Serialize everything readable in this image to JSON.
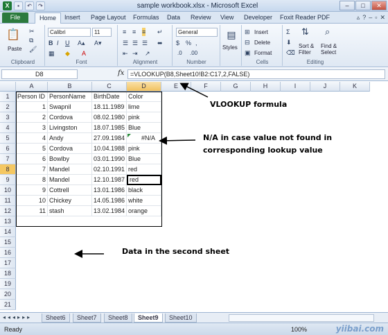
{
  "window": {
    "title": "sample workbook.xlsx - Microsoft Excel",
    "buttons": [
      "–",
      "□",
      "✕"
    ]
  },
  "tabs": [
    "File",
    "Home",
    "Insert",
    "Page Layout",
    "Formulas",
    "Data",
    "Review",
    "View",
    "Developer",
    "Foxit Reader PDF"
  ],
  "ribbon": {
    "paste": "Paste",
    "font_name": "Calibri",
    "font_size": "11",
    "bold": "B",
    "italic": "I",
    "underline": "U",
    "number_format": "General",
    "styles": "Styles",
    "insert": "Insert",
    "delete": "Delete",
    "format": "Format",
    "sort_filter": "Sort & Filter",
    "find_select": "Find & Select",
    "groups": [
      "Clipboard",
      "Font",
      "Alignment",
      "Number",
      "Cells",
      "Editing"
    ]
  },
  "formula_bar": {
    "name_box": "D8",
    "fx": "fx",
    "formula": "=VLOOKUP(B8,Sheet10!B2:C17,2,FALSE)"
  },
  "columns": [
    "A",
    "B",
    "C",
    "D",
    "E",
    "F",
    "G",
    "H",
    "I",
    "J",
    "K"
  ],
  "rows": [
    "1",
    "2",
    "3",
    "4",
    "5",
    "6",
    "7",
    "8",
    "9",
    "10",
    "11",
    "12",
    "13",
    "14",
    "15",
    "16",
    "17",
    "18",
    "19",
    "20",
    "21"
  ],
  "table": {
    "headers": [
      "Person ID",
      "PersonName",
      "BirthDate",
      "Color"
    ],
    "rows": [
      [
        "1",
        "Swapnil",
        "18.11.1989",
        "lime"
      ],
      [
        "2",
        "Cordova",
        "08.02.1980",
        "pink"
      ],
      [
        "3",
        "Livingston",
        "18.07.1985",
        "Blue"
      ],
      [
        "4",
        "Andy",
        "27.09.1984",
        "#N/A"
      ],
      [
        "5",
        "Cordova",
        "10.04.1988",
        "pink"
      ],
      [
        "6",
        "Bowlby",
        "03.01.1990",
        "Blue"
      ],
      [
        "7",
        "Mandel",
        "02.10.1991",
        "red"
      ],
      [
        "8",
        "Mandel",
        "12.10.1987",
        "red"
      ],
      [
        "9",
        "Cottrell",
        "13.01.1986",
        "black"
      ],
      [
        "10",
        "Chickey",
        "14.05.1986",
        "white"
      ],
      [
        "11",
        "stash",
        "13.02.1984",
        "orange"
      ]
    ]
  },
  "annotations": {
    "vlookup": "VLOOKUP formula",
    "na_line1": "N/A in case value not found in",
    "na_line2": "corresponding lookup value",
    "second_sheet": "Data in the second sheet"
  },
  "sheets": [
    "Sheet6",
    "Sheet7",
    "Sheet8",
    "Sheet9",
    "Sheet10"
  ],
  "active_sheet": "Sheet9",
  "status": {
    "ready": "Ready",
    "zoom": "100%",
    "watermark": "yiibai.com"
  }
}
